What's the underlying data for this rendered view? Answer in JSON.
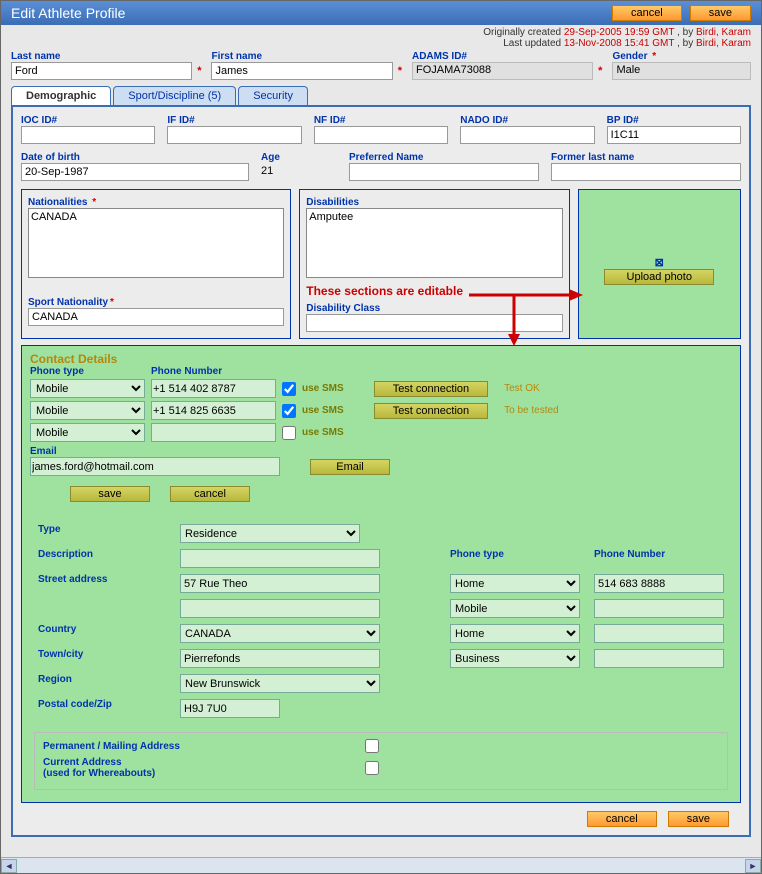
{
  "title": "Edit Athlete Profile",
  "buttons": {
    "cancel": "cancel",
    "save": "save",
    "upload_photo": "Upload photo",
    "test_connection": "Test connection",
    "email": "Email"
  },
  "meta": {
    "created_label": "Originally created ",
    "created_date": "29-Sep-2005 19:59 GMT",
    "by": " , by ",
    "created_by": "Birdi, Karam",
    "updated_label": "Last updated ",
    "updated_date": "13-Nov-2008 15:41 GMT",
    "updated_by": "Birdi, Karam"
  },
  "top": {
    "last_name_label": "Last name",
    "last_name": "Ford",
    "first_name_label": "First name",
    "first_name": "James",
    "adams_label": "ADAMS ID#",
    "adams_id": "FOJAMA73088",
    "gender_label": "Gender",
    "gender": "Male"
  },
  "tabs": {
    "demo": "Demographic",
    "sport": "Sport/Discipline (5)",
    "security": "Security"
  },
  "ids": {
    "ioc": "IOC ID#",
    "if": "IF ID#",
    "nf": "NF ID#",
    "nado": "NADO ID#",
    "bp": "BP ID#",
    "bp_val": "I1C11"
  },
  "dob": {
    "label": "Date of birth",
    "value": "20-Sep-1987",
    "age_label": "Age",
    "age": "21",
    "pref_label": "Preferred Name",
    "former_label": "Former last name"
  },
  "nat": {
    "label": "Nationalities",
    "value": "CANADA",
    "sport_label": "Sport Nationality",
    "sport_value": "CANADA"
  },
  "dis": {
    "label": "Disabilities",
    "value": "Amputee",
    "class_label": "Disability Class"
  },
  "annotation": "These sections are editable",
  "contact": {
    "title": "Contact Details",
    "phone_type_label": "Phone type",
    "phone_number_label": "Phone Number",
    "use_sms": "use SMS",
    "rows": [
      {
        "type": "Mobile",
        "number": "+1 514 402 8787",
        "sms": true,
        "status": "Test OK"
      },
      {
        "type": "Mobile",
        "number": "+1 514 825 6635",
        "sms": true,
        "status": "To be tested"
      },
      {
        "type": "Mobile",
        "number": "",
        "sms": false,
        "status": ""
      }
    ],
    "email_label": "Email",
    "email": "james.ford@hotmail.com"
  },
  "address": {
    "type_label": "Type",
    "type": "Residence",
    "desc_label": "Description",
    "desc": "",
    "street_label": "Street address",
    "street": "57 Rue Theo",
    "street2": "",
    "country_label": "Country",
    "country": "CANADA",
    "town_label": "Town/city",
    "town": "Pierrefonds",
    "region_label": "Region",
    "region": "New Brunswick",
    "postal_label": "Postal code/Zip",
    "postal": "H9J 7U0",
    "phone_type_label": "Phone type",
    "phone_number_label": "Phone Number",
    "phones": [
      {
        "type": "Home",
        "number": "514 683 8888"
      },
      {
        "type": "Mobile",
        "number": ""
      },
      {
        "type": "Home",
        "number": ""
      },
      {
        "type": "Business",
        "number": ""
      }
    ],
    "perm_label": "Permanent / Mailing Address",
    "current_label": "Current Address",
    "current_sub": "(used for Whereabouts)"
  }
}
